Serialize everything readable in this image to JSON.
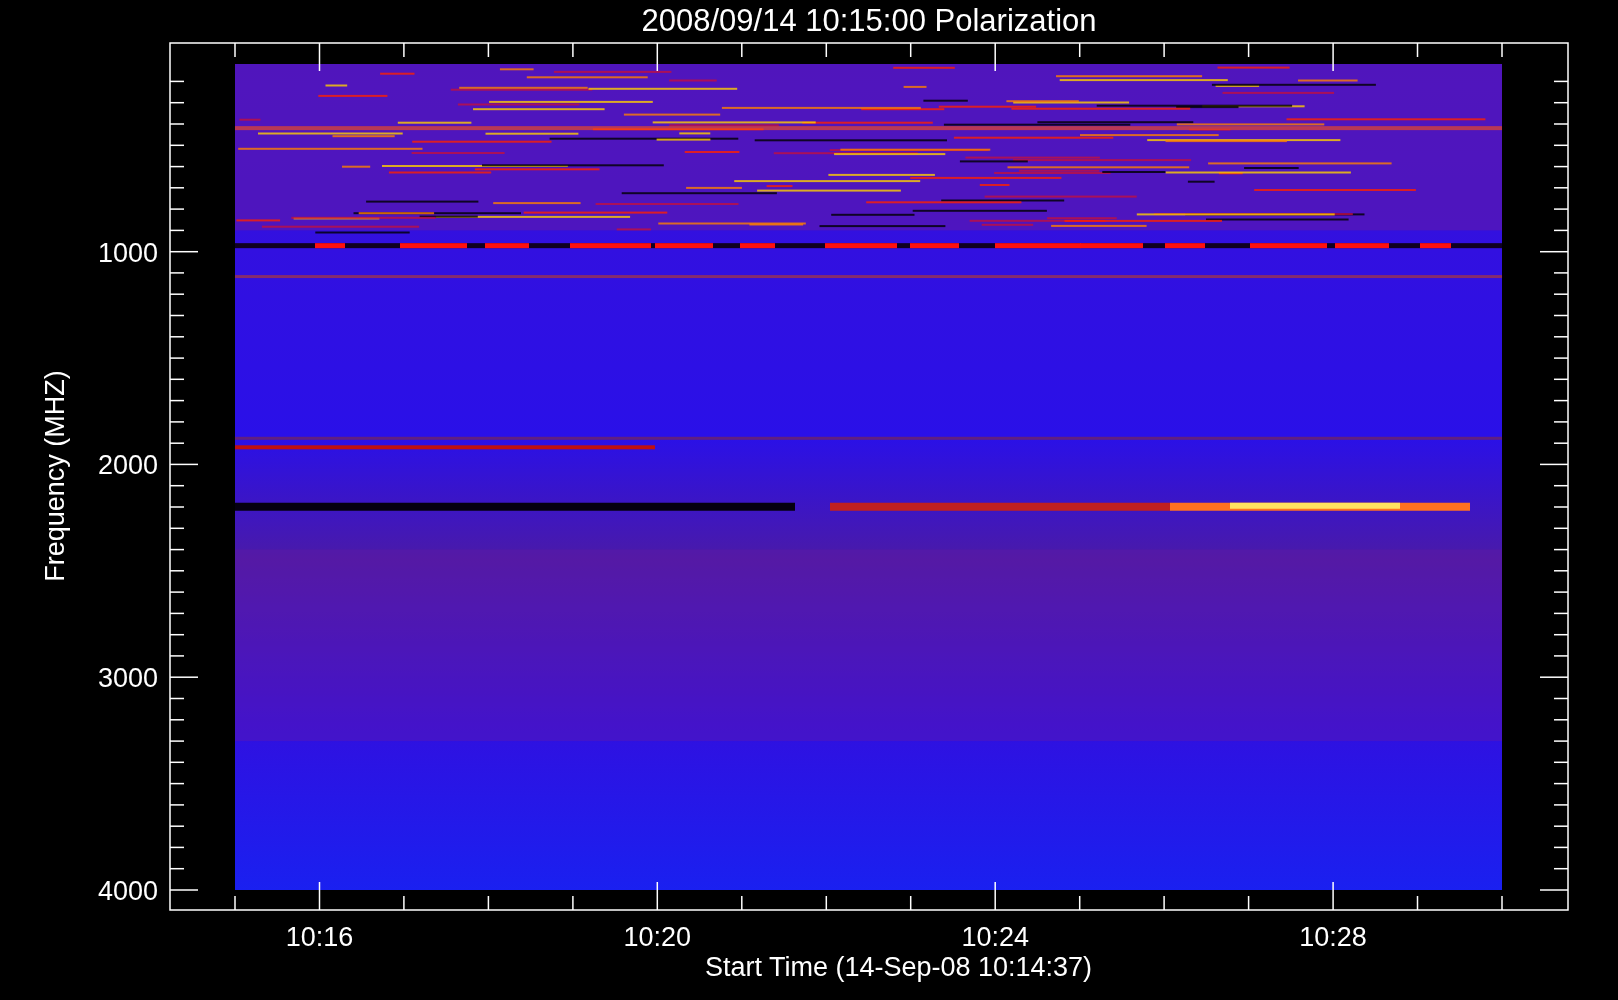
{
  "title": "2008/09/14 10:15:00 Polarization",
  "y_axis": {
    "label": "Frequency (MHZ)",
    "ticks": [
      "1000",
      "2000",
      "3000",
      "4000"
    ]
  },
  "x_axis": {
    "label": "Start Time (14-Sep-08 10:14:37)",
    "ticks": [
      "10:16",
      "10:20",
      "10:24",
      "10:28"
    ]
  }
}
